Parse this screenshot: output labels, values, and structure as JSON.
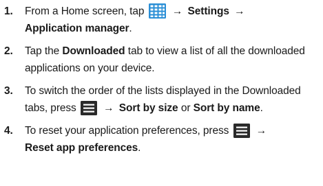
{
  "steps": [
    {
      "number": "1.",
      "text_before": "From a Home screen, tap",
      "icon": "apps-grid-icon",
      "arrow1": "→",
      "bold1": "Settings",
      "arrow2": "→",
      "bold2": "Application manager",
      "text_after": "."
    },
    {
      "number": "2.",
      "text_before": "Tap the",
      "bold1": "Downloaded",
      "text_after": "tab to view a list of all the downloaded applications on your device."
    },
    {
      "number": "3.",
      "text_before": "To switch the order of the lists displayed in the Downloaded tabs, press",
      "icon": "menu-icon",
      "arrow1": "→",
      "bold1": "Sort by size",
      "text_mid": "or",
      "bold2": "Sort by name",
      "text_after": "."
    },
    {
      "number": "4.",
      "text_before": "To reset your application preferences, press",
      "icon": "menu-icon",
      "arrow1": "→",
      "bold1": "Reset app preferences",
      "text_after": "."
    }
  ],
  "colors": {
    "grid_icon_fill": "#2b8fd6",
    "menu_icon_fill": "#2a2a2a",
    "text": "#1a1a1a"
  }
}
